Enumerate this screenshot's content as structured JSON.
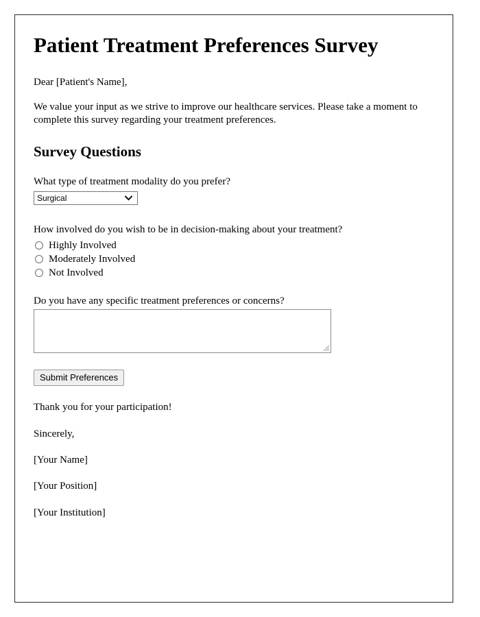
{
  "document": {
    "title": "Patient Treatment Preferences Survey",
    "salutation": "Dear [Patient's Name],",
    "intro_paragraph": "We value your input as we strive to improve our healthcare services. Please take a moment to complete this survey regarding your treatment preferences.",
    "section_heading": "Survey Questions"
  },
  "questions": {
    "modality": {
      "label": "What type of treatment modality do you prefer?",
      "selected_value": "Surgical",
      "arrow_icon": "chevron-down-icon"
    },
    "involvement": {
      "label": "How involved do you wish to be in decision-making about your treatment?",
      "options": [
        {
          "label": "Highly Involved",
          "checked": false
        },
        {
          "label": "Moderately Involved",
          "checked": false
        },
        {
          "label": "Not Involved",
          "checked": false
        }
      ]
    },
    "comments": {
      "label": "Do you have any specific treatment preferences or concerns?",
      "value": "",
      "placeholder": "",
      "resize_icon": "resize-grip-icon"
    }
  },
  "actions": {
    "submit_label": "Submit Preferences"
  },
  "closing": {
    "thank_you": "Thank you for your participation!",
    "sign_off": "Sincerely,",
    "name": "[Your Name]",
    "position": "[Your Position]",
    "institution": "[Your Institution]"
  },
  "colors": {
    "page_border": "#2b2b2b",
    "text": "#000000",
    "field_border": "#767676",
    "button_background": "#efefef",
    "button_border": "#9a9a9a"
  }
}
